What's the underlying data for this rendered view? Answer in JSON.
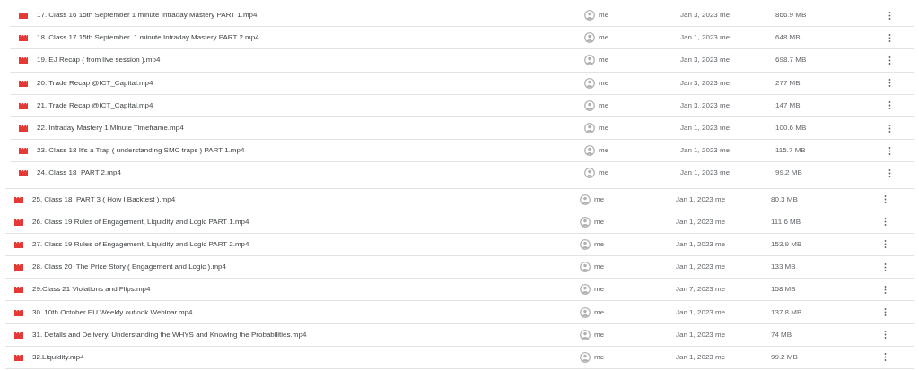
{
  "groups": [
    {
      "rows": [
        {
          "name": "17. Class 16 15th September 1 minute Intraday Mastery PART 1.mp4",
          "owner": "me",
          "modified": "Jan 3, 2023 me",
          "size": "866.9 MB"
        },
        {
          "name": "18. Class 17 15th September  1 minute Intraday Mastery PART 2.mp4",
          "owner": "me",
          "modified": "Jan 1, 2023 me",
          "size": "648 MB"
        },
        {
          "name": "19. EJ Recap ( from live session ).mp4",
          "owner": "me",
          "modified": "Jan 3, 2023 me",
          "size": "698.7 MB"
        },
        {
          "name": "20. Trade Recap @ICT_Capital.mp4",
          "owner": "me",
          "modified": "Jan 3, 2023 me",
          "size": "277 MB"
        },
        {
          "name": "21. Trade Recap @ICT_Capital.mp4",
          "owner": "me",
          "modified": "Jan 3, 2023 me",
          "size": "147 MB"
        },
        {
          "name": "22. Intraday Mastery 1 Minute Timeframe.mp4",
          "owner": "me",
          "modified": "Jan 1, 2023 me",
          "size": "100.6 MB"
        },
        {
          "name": "23. Class 18 It's a Trap ( understanding SMC traps ) PART 1.mp4",
          "owner": "me",
          "modified": "Jan 1, 2023 me",
          "size": "115.7 MB"
        },
        {
          "name": "24. Class 18  PART 2.mp4",
          "owner": "me",
          "modified": "Jan 1, 2023 me",
          "size": "99.2 MB"
        }
      ]
    },
    {
      "rows": [
        {
          "name": "25. Class 18  PART 3 ( How I Backtest ).mp4",
          "owner": "me",
          "modified": "Jan 1, 2023 me",
          "size": "80.3 MB"
        },
        {
          "name": "26. Class 19 Rules of Engagement, Liquidity and Logic PART 1.mp4",
          "owner": "me",
          "modified": "Jan 1, 2023 me",
          "size": "111.6 MB"
        },
        {
          "name": "27. Class 19 Rules of Engagement, Liquidity and Logic PART 2.mp4",
          "owner": "me",
          "modified": "Jan 1, 2023 me",
          "size": "153.9 MB"
        },
        {
          "name": "28. Class 20  The Price Story ( Engagement and Logic ).mp4",
          "owner": "me",
          "modified": "Jan 1, 2023 me",
          "size": "133 MB"
        },
        {
          "name": "29.Class 21 Violations and Flips.mp4",
          "owner": "me",
          "modified": "Jan 7, 2023 me",
          "size": "158 MB"
        },
        {
          "name": "30. 10th October EU Weekly outlook Webinar.mp4",
          "owner": "me",
          "modified": "Jan 1, 2023 me",
          "size": "137.8 MB"
        },
        {
          "name": "31. Details and Delivery, Understanding the WHYS and Knowing the Probabilities.mp4",
          "owner": "me",
          "modified": "Jan 1, 2023 me",
          "size": "74 MB"
        },
        {
          "name": "32.Liquidity.mp4",
          "owner": "me",
          "modified": "Jan 1, 2023 me",
          "size": "99.2 MB"
        }
      ]
    }
  ]
}
